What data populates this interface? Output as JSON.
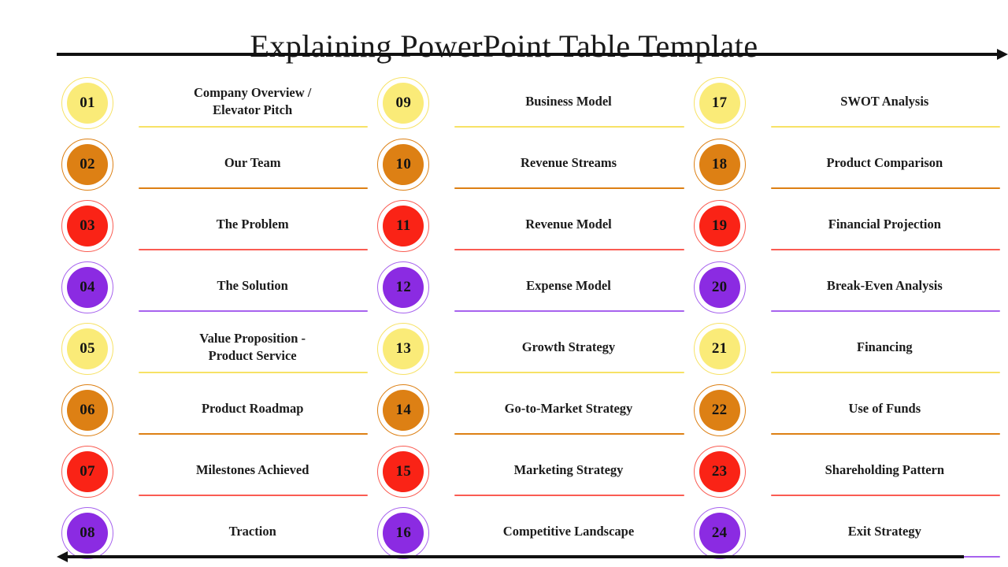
{
  "slide": {
    "title": "Explaining PowerPoint Table Template",
    "top_rule": "arrow-right",
    "bottom_rule": "arrow-left"
  },
  "palette": {
    "yellow": "#FAEB78",
    "yellow_ring": "#F7E266",
    "orange": "#DD8014",
    "orange_ring": "#DD8014",
    "red": "#FA2316",
    "red_ring": "#FA5C52",
    "purple": "#8B2BE2",
    "purple_ring": "#A763EE",
    "text": "#1B1B1B",
    "rule": "#111111"
  },
  "columns": [
    {
      "name": "column-one",
      "items": [
        {
          "number": "01",
          "label": "Company Overview /\nElevator Pitch",
          "color": "yellow"
        },
        {
          "number": "02",
          "label": "Our Team",
          "color": "orange"
        },
        {
          "number": "03",
          "label": "The Problem",
          "color": "red"
        },
        {
          "number": "04",
          "label": "The Solution",
          "color": "purple"
        },
        {
          "number": "05",
          "label": "Value Proposition -\nProduct Service",
          "color": "yellow"
        },
        {
          "number": "06",
          "label": "Product Roadmap",
          "color": "orange"
        },
        {
          "number": "07",
          "label": "Milestones Achieved",
          "color": "red"
        },
        {
          "number": "08",
          "label": "Traction",
          "color": "purple"
        }
      ]
    },
    {
      "name": "column-two",
      "items": [
        {
          "number": "09",
          "label": "Business Model",
          "color": "yellow"
        },
        {
          "number": "10",
          "label": "Revenue Streams",
          "color": "orange"
        },
        {
          "number": "11",
          "label": "Revenue Model",
          "color": "red"
        },
        {
          "number": "12",
          "label": "Expense Model",
          "color": "purple"
        },
        {
          "number": "13",
          "label": "Growth Strategy",
          "color": "yellow"
        },
        {
          "number": "14",
          "label": "Go-to-Market Strategy",
          "color": "orange"
        },
        {
          "number": "15",
          "label": "Marketing Strategy",
          "color": "red"
        },
        {
          "number": "16",
          "label": "Competitive Landscape",
          "color": "purple"
        }
      ]
    },
    {
      "name": "column-three",
      "items": [
        {
          "number": "17",
          "label": "SWOT Analysis",
          "color": "yellow"
        },
        {
          "number": "18",
          "label": "Product Comparison",
          "color": "orange"
        },
        {
          "number": "19",
          "label": "Financial Projection",
          "color": "red"
        },
        {
          "number": "20",
          "label": "Break-Even Analysis",
          "color": "purple"
        },
        {
          "number": "21",
          "label": "Financing",
          "color": "yellow"
        },
        {
          "number": "22",
          "label": "Use of Funds",
          "color": "orange"
        },
        {
          "number": "23",
          "label": "Shareholding Pattern",
          "color": "red"
        },
        {
          "number": "24",
          "label": "Exit Strategy",
          "color": "purple"
        }
      ]
    }
  ]
}
